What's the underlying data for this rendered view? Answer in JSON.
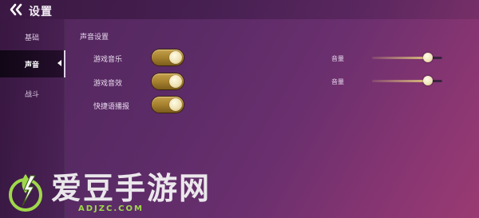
{
  "header": {
    "title": "设置",
    "back_icon": "chevron-left-icon"
  },
  "sidebar": {
    "items": [
      {
        "label": "基础",
        "active": false
      },
      {
        "label": "声音",
        "active": true
      },
      {
        "label": "战斗",
        "active": false
      }
    ]
  },
  "sound_settings": {
    "section_title": "声音设置",
    "rows": [
      {
        "label": "游戏音乐",
        "toggle_on": true,
        "volume_label": "音量",
        "volume_level_pct": 80
      },
      {
        "label": "游戏音效",
        "toggle_on": true,
        "volume_label": "音量",
        "volume_level_pct": 80
      },
      {
        "label": "快捷语播报",
        "toggle_on": true
      }
    ]
  },
  "watermark": {
    "text": "爱豆手游网",
    "sub": "ADJZC.COM"
  },
  "colors": {
    "accent_gold": "#b08a36",
    "background": "#5a2b66",
    "watermark_green": "#9fd84a"
  }
}
